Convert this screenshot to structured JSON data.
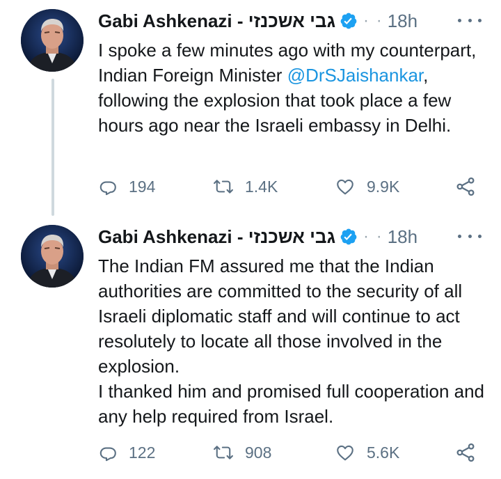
{
  "tweets": [
    {
      "author": {
        "display_name": "Gabi Ashkenazi - גבי אשכנזי",
        "verified_icon": "verified-badge-icon",
        "separator": "· ·",
        "time": "18h",
        "avatar": "avatar-photo"
      },
      "text_before": "I spoke a few minutes ago with my counterpart, Indian Foreign Minister ",
      "mention": "@DrSJaishankar",
      "text_after": ", following the explosion that took place a few hours ago near the Israeli embassy in Delhi.",
      "actions": {
        "replies": "194",
        "retweets": "1.4K",
        "likes": "9.9K"
      }
    },
    {
      "author": {
        "display_name": "Gabi Ashkenazi - גבי אשכנזי",
        "verified_icon": "verified-badge-icon",
        "separator": "· ·",
        "time": "18h",
        "avatar": "avatar-photo"
      },
      "text": "The Indian FM assured me that the Indian authorities are committed to the security of all Israeli diplomatic staff and will continue to act resolutely to locate all those involved in the explosion.\nI thanked him and promised full cooperation and any help required from Israel.",
      "actions": {
        "replies": "122",
        "retweets": "908",
        "likes": "5.6K"
      }
    }
  ],
  "icons": {
    "reply": "reply-icon",
    "retweet": "retweet-icon",
    "like": "heart-icon",
    "share": "share-icon",
    "more": "more-options-icon"
  },
  "colors": {
    "verified": "#1da1f2",
    "link": "#1b95e0",
    "secondary_text": "#5b7083",
    "thread_line": "#cfd9de"
  }
}
